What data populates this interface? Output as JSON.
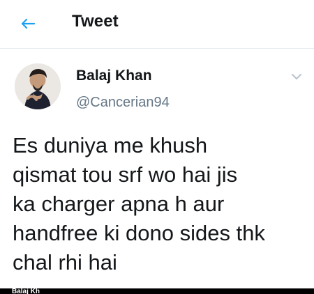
{
  "header": {
    "title": "Tweet",
    "back_icon": "back-arrow-icon",
    "accent_color": "#1da1f2"
  },
  "tweet": {
    "author": {
      "display_name": "Balaj Khan",
      "handle": "@Cancerian94",
      "avatar": "profile-photo"
    },
    "menu_icon": "chevron-down-icon",
    "text_lines": [
      "Es duniya me khush",
      "qismat tou srf wo hai jis",
      "ka charger apna h aur",
      "handfree ki dono sides thk",
      "chal rhi hai"
    ]
  },
  "footer": {
    "cropped_text": "Balaj Kh"
  }
}
